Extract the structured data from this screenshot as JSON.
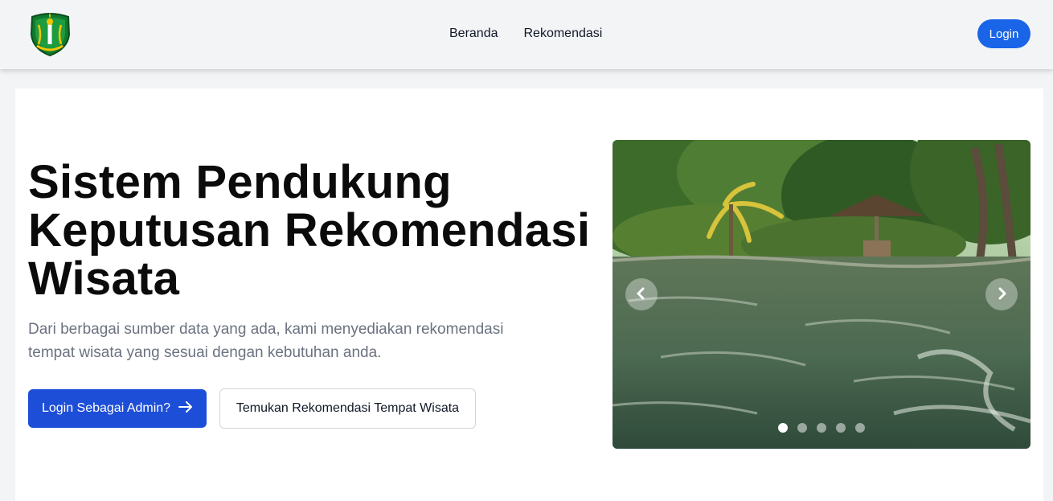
{
  "nav": {
    "links": [
      "Beranda",
      "Rekomendasi"
    ],
    "login_label": "Login",
    "logo_icon": "regional-emblem-logo"
  },
  "hero": {
    "title_line1": "Sistem Pendukung",
    "title_line2": "Keputusan Rekomendasi",
    "title_line3": "Wisata",
    "subtitle_line1": "Dari berbagai sumber data yang ada, kami menyediakan rekomendasi",
    "subtitle_line2": "tempat wisata yang sesuai dengan kebutuhan anda.",
    "admin_button": "Login Sebagai Admin?",
    "find_button": "Temukan Rekomendasi Tempat Wisata"
  },
  "carousel": {
    "slide_count": 5,
    "active_index": 0,
    "prev_icon": "chevron-left-icon",
    "next_icon": "chevron-right-icon"
  },
  "colors": {
    "accent": "#1a64e8",
    "admin_button": "#1d4ed8",
    "page_bg": "#f3f4f6"
  }
}
